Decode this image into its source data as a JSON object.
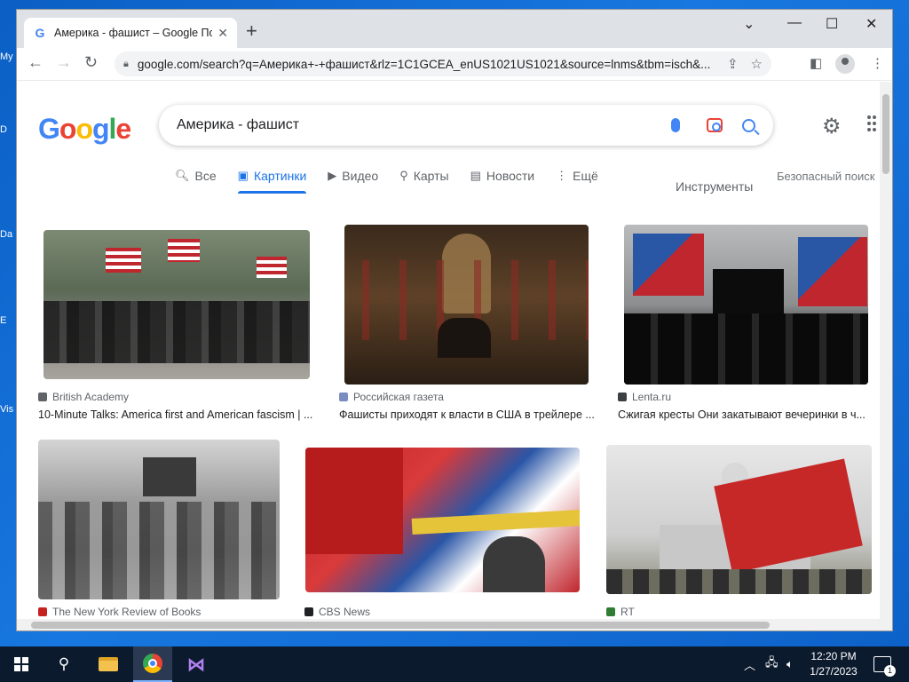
{
  "desktop": {
    "icons": [
      "My",
      "D",
      "Da",
      "E",
      "Vis"
    ]
  },
  "browser": {
    "tab_title": "Америка - фашист – Google По",
    "new_tab": "+",
    "window_controls": {
      "minimize": "—",
      "maximize": "☐",
      "close": "✕",
      "tab_search": "⌄"
    },
    "url": "google.com/search?q=Америка+-+фашист&rlz=1C1GCEA_enUS1021US1021&source=lnms&tbm=isch&..."
  },
  "page": {
    "logo": [
      "G",
      "o",
      "o",
      "g",
      "l",
      "e"
    ],
    "query": "Америка - фашист",
    "tabs": [
      {
        "label": "Все",
        "icon": "🔍︎"
      },
      {
        "label": "Картинки",
        "icon": "▣"
      },
      {
        "label": "Видео",
        "icon": "▶"
      },
      {
        "label": "Карты",
        "icon": "⚲"
      },
      {
        "label": "Новости",
        "icon": "▤"
      },
      {
        "label": "Ещё",
        "icon": "⋮"
      }
    ],
    "tools": "Инструменты",
    "safesearch": "Безопасный поиск",
    "results": [
      {
        "source": "British Academy",
        "caption": "10-Minute Talks: America first and American fascism | ...",
        "source_color": "#5f6368"
      },
      {
        "source": "Российская газета",
        "caption": "Фашисты приходят к власти в США в трейлере ...",
        "source_color": "#7b8cc1"
      },
      {
        "source": "Lenta.ru",
        "caption": "Сжигая кресты Они закатывают вечеринки в ч...",
        "source_color": "#3c4043"
      },
      {
        "source": "The New York Review of Books",
        "caption": "",
        "source_color": "#c5221f"
      },
      {
        "source": "CBS News",
        "caption": "",
        "source_color": "#202124"
      },
      {
        "source": "RT",
        "caption": "",
        "source_color": "#2e7d32"
      }
    ]
  },
  "taskbar": {
    "time": "12:20 PM",
    "date": "1/27/2023",
    "notifications": "1"
  }
}
